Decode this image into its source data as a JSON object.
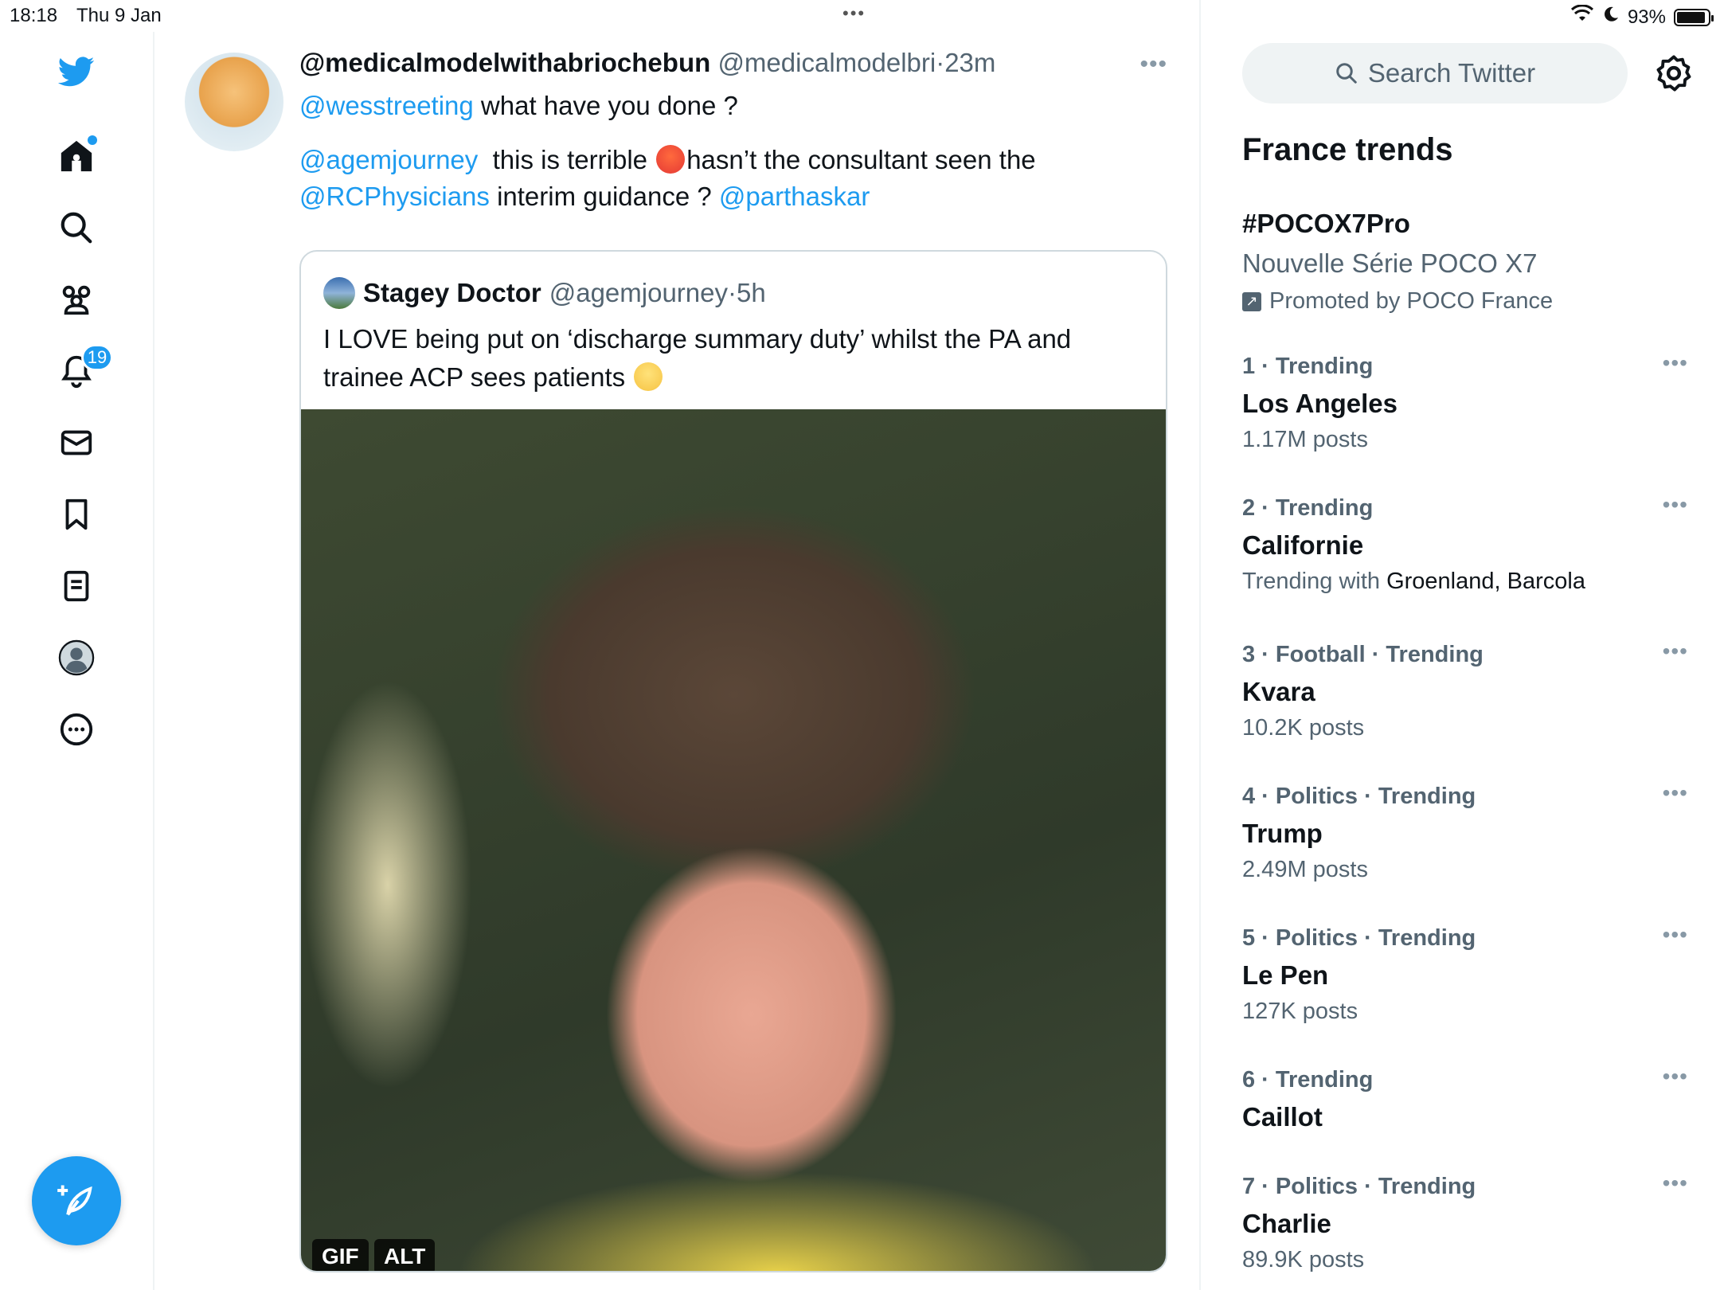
{
  "status_bar": {
    "time": "18:18",
    "date": "Thu 9 Jan",
    "center_dots": "•••",
    "battery": "93%",
    "battery_level": 0.93
  },
  "left_nav": {
    "items": [
      "Home",
      "Explore",
      "Communities",
      "Notifications",
      "Messages",
      "Bookmarks",
      "Lists",
      "Profile",
      "More"
    ],
    "notifications_badge": "19",
    "icons": [
      "twitter-logo-icon",
      "home-icon",
      "search-icon",
      "communities-icon",
      "bell-icon",
      "mail-icon",
      "bookmark-icon",
      "lists-icon",
      "profile-avatar-icon",
      "more-icon",
      "compose-icon"
    ],
    "accent": "#1d9bf0"
  },
  "tweet": {
    "display_name": "@medicalmodelwithabriochebun",
    "handle": "@medicalmodelbri",
    "separator": "·",
    "time": "23m",
    "more": "•••",
    "line1_mention": "@wesstreeting",
    "line1_text": " what have you done ?",
    "line2_mention": "@agemjourney",
    "line2_text_a": "  this is terrible ",
    "line2_text_b": "hasn’t the consultant seen the",
    "line3_mention": "@RCPhysicians",
    "line3_text": " interim guidance ? ",
    "line3_mention2": "@parthaskar"
  },
  "quote": {
    "display_name": "Stagey Doctor",
    "handle": "@agemjourney",
    "separator": "·",
    "time": "5h",
    "text_line1": "I LOVE being put on ‘discharge summary duty’ whilst the PA and",
    "text_line2": "trainee ACP sees patients ",
    "badge_gif": "GIF",
    "badge_alt": "ALT"
  },
  "sidebar": {
    "search_placeholder": "Search Twitter",
    "trends_title": "France trends",
    "promoted": {
      "tag": "#POCOX7Pro",
      "description": "Nouvelle Série POCO X7",
      "by": "Promoted by POCO France"
    },
    "trends": [
      {
        "meta": "1 · Trending",
        "name": "Los Angeles",
        "sub": "1.17M posts",
        "sub_strong": ""
      },
      {
        "meta": "2 · Trending",
        "name": "Californie",
        "sub": "Trending with ",
        "sub_strong": "Groenland, Barcola"
      },
      {
        "meta": "3 · Football · Trending",
        "name": "Kvara",
        "sub": "10.2K posts",
        "sub_strong": ""
      },
      {
        "meta": "4 · Politics · Trending",
        "name": "Trump",
        "sub": "2.49M posts",
        "sub_strong": ""
      },
      {
        "meta": "5 · Politics · Trending",
        "name": "Le Pen",
        "sub": "127K posts",
        "sub_strong": ""
      },
      {
        "meta": "6 · Trending",
        "name": "Caillot",
        "sub": "",
        "sub_strong": ""
      },
      {
        "meta": "7 · Politics · Trending",
        "name": "Charlie",
        "sub": "89.9K posts",
        "sub_strong": ""
      }
    ],
    "more": "•••"
  }
}
